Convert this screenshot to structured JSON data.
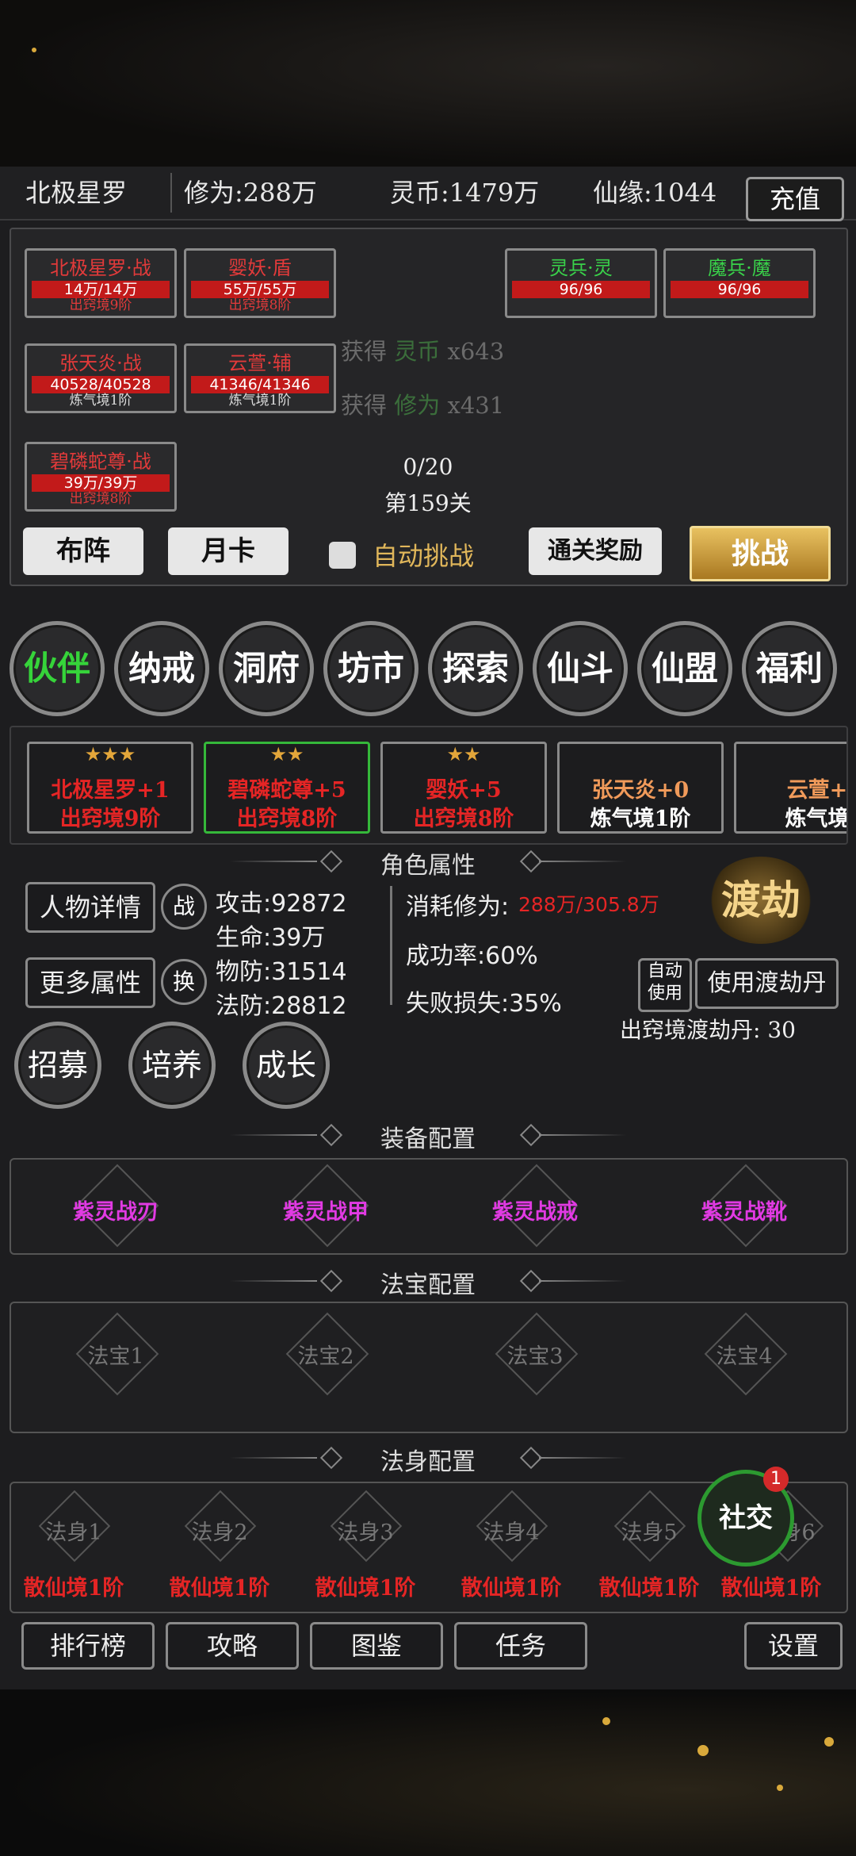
{
  "header": {
    "player_name": "北极星罗",
    "cultivation": "修为:288万",
    "spirit_coin": "灵币:1479万",
    "fate": "仙缘:1044",
    "recharge_label": "充值"
  },
  "battle": {
    "cards": [
      {
        "name": "北极星罗·战",
        "hp": "14万/14万",
        "realm": "出窍境9阶",
        "hp_fraction": 1.0
      },
      {
        "name": "婴妖·盾",
        "hp": "55万/55万",
        "realm": "出窍境8阶",
        "hp_fraction": 1.0
      },
      {
        "name": "张天炎·战",
        "hp": "40528/40528",
        "realm": "炼气境1阶",
        "hp_fraction": 1.0
      },
      {
        "name": "云萱·辅",
        "hp": "41346/41346",
        "realm": "炼气境1阶",
        "hp_fraction": 1.0
      },
      {
        "name": "碧磷蛇尊·战",
        "hp": "39万/39万",
        "realm": "出窍境8阶",
        "hp_fraction": 1.0
      }
    ],
    "enemies": [
      {
        "name": "灵兵·灵",
        "hp": "96/96"
      },
      {
        "name": "魔兵·魔",
        "hp": "96/96"
      }
    ],
    "loot": [
      {
        "prefix": "获得",
        "item": "灵币",
        "count": "x643"
      },
      {
        "prefix": "获得",
        "item": "修为",
        "count": "x431"
      }
    ],
    "progress": "0/20",
    "stage": "第159关",
    "formation_label": "布阵",
    "monthly_card_label": "月卡",
    "auto_label": "自动挑战",
    "clear_reward_label": "通关奖励",
    "challenge_label": "挑战"
  },
  "menu": [
    "伙伴",
    "纳戒",
    "洞府",
    "坊市",
    "探索",
    "仙斗",
    "仙盟",
    "福利"
  ],
  "roster": [
    {
      "stars": "★★★",
      "l1": "北极星罗+1",
      "l2": "出窍境9阶"
    },
    {
      "stars": "★★",
      "l1": "碧磷蛇尊+5",
      "l2": "出窍境8阶"
    },
    {
      "stars": "★★",
      "l1": "婴妖+5",
      "l2": "出窍境8阶"
    },
    {
      "stars": "",
      "l1": "张天炎+0",
      "l2": "炼气境1阶"
    },
    {
      "stars": "",
      "l1": "云萱+",
      "l2": "炼气境"
    }
  ],
  "attributes": {
    "title": "角色属性",
    "detail_label": "人物详情",
    "battle_label": "战",
    "more_label": "更多属性",
    "swap_label": "换",
    "attack": "攻击:92872",
    "life": "生命:39万",
    "pdef": "物防:31514",
    "mdef": "法防:28812",
    "cost_label": "消耗修为:",
    "cost_value": "288万/305.8万",
    "success": "成功率:60%",
    "fail": "失败损失:35%",
    "dujie_label": "渡劫",
    "auto_use_line1": "自动",
    "auto_use_line2": "使用",
    "use_pill_label": "使用渡劫丹",
    "pill_count": "出窍境渡劫丹: 30",
    "recruit_label": "招募",
    "train_label": "培养",
    "grow_label": "成长"
  },
  "equipment": {
    "title": "装备配置",
    "slots": [
      "紫灵战刃",
      "紫灵战甲",
      "紫灵战戒",
      "紫灵战靴"
    ]
  },
  "treasure": {
    "title": "法宝配置",
    "slots": [
      "法宝1",
      "法宝2",
      "法宝3",
      "法宝4"
    ]
  },
  "body": {
    "title": "法身配置",
    "slots": [
      {
        "name": "法身1",
        "realm": "散仙境1阶"
      },
      {
        "name": "法身2",
        "realm": "散仙境1阶"
      },
      {
        "name": "法身3",
        "realm": "散仙境1阶"
      },
      {
        "name": "法身4",
        "realm": "散仙境1阶"
      },
      {
        "name": "法身5",
        "realm": "散仙境1阶"
      },
      {
        "name": "法身6",
        "realm": "散仙境1阶"
      }
    ]
  },
  "social": {
    "label": "社交",
    "badge": "1"
  },
  "bottom": {
    "ranking": "排行榜",
    "guide": "攻略",
    "atlas": "图鉴",
    "task": "任务",
    "settings": "设置"
  },
  "colors": {
    "red": "#e52525",
    "green": "#36d43a",
    "gold": "#e0b65a",
    "magenta": "#e13ae3"
  }
}
